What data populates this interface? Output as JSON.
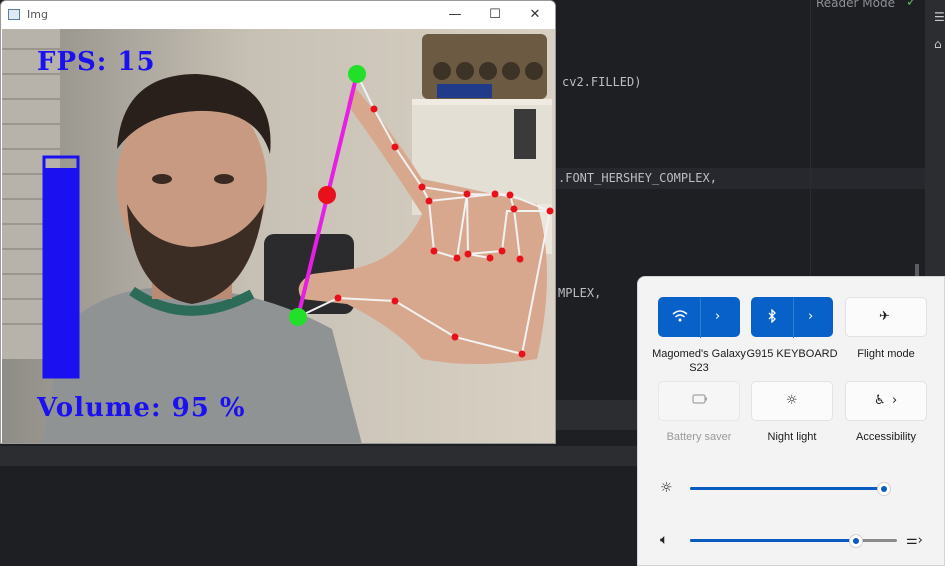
{
  "editor": {
    "reader_mode": "Reader Mode",
    "code_lines": [
      "cv2.FILLED)",
      ".FONT_HERSHEY_COMPLEX,",
      "MPLEX,"
    ]
  },
  "window": {
    "title": "Img",
    "minimize_icon": "minimize-icon",
    "maximize_icon": "maximize-icon",
    "close_icon": "close-icon"
  },
  "overlay": {
    "fps": "FPS: 15",
    "volume": "Volume: 95 %",
    "volume_level": 0.95
  },
  "quick_settings": {
    "tiles": [
      {
        "name": "wifi",
        "icon": "wifi-icon",
        "label": "Magomed's Galaxy S23",
        "on": true
      },
      {
        "name": "bluetooth",
        "icon": "bluetooth-icon",
        "label": "G915 KEYBOARD",
        "on": true
      },
      {
        "name": "flight-mode",
        "icon": "airplane-icon",
        "label": "Flight mode",
        "on": false
      },
      {
        "name": "battery-saver",
        "icon": "battery-icon",
        "label": "Battery saver",
        "on": false,
        "disabled": true
      },
      {
        "name": "night-light",
        "icon": "brightness-icon",
        "label": "Night light",
        "on": false
      },
      {
        "name": "accessibility",
        "icon": "accessibility-icon",
        "label": "Accessibility",
        "on": false
      }
    ],
    "brightness": 0.97,
    "volume": 0.8
  },
  "colors": {
    "accent": "#0861c8",
    "overlay_text": "#1a10f0",
    "landmark_red": "#e8101a",
    "line_magenta": "#e61ee6",
    "fingertip_green": "#22e02a"
  }
}
